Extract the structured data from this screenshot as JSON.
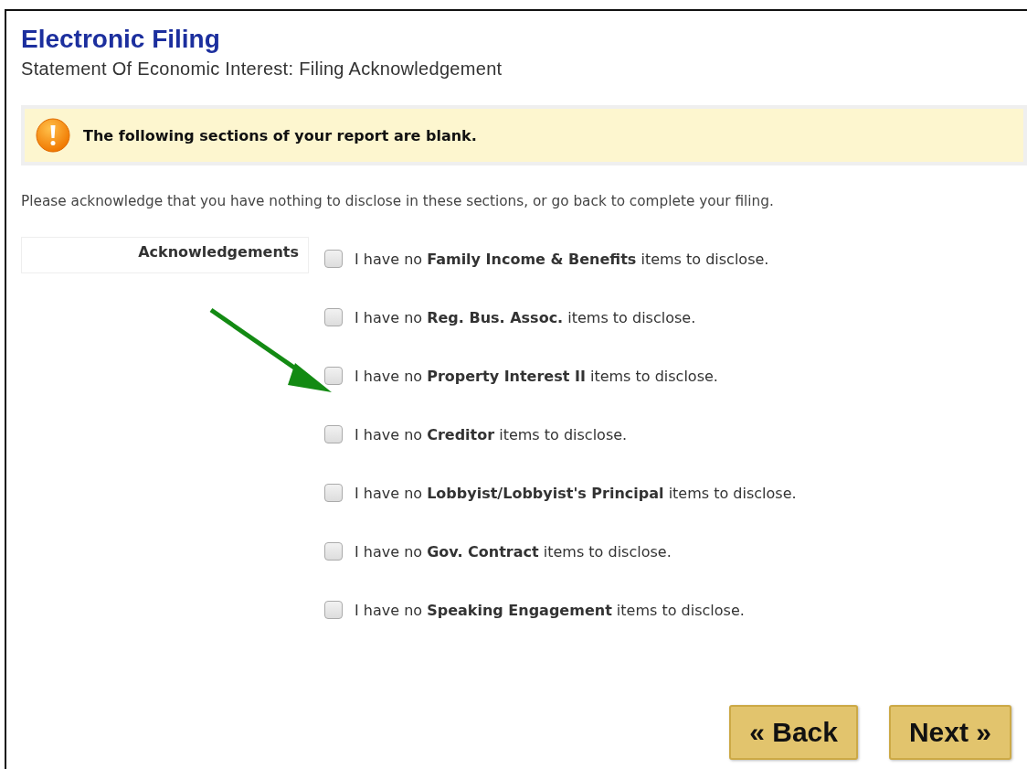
{
  "header": {
    "title": "Electronic Filing",
    "subtitle": "Statement Of Economic Interest: Filing Acknowledgement"
  },
  "alert": {
    "message": "The following sections of your report are blank."
  },
  "instructions": "Please acknowledge that you have nothing to disclose in these sections, or go back to complete your filing.",
  "acknowledgements": {
    "label": "Acknowledgements",
    "items": [
      {
        "text": "I have no **Family Income & Benefits** items to disclose.",
        "checked": false
      },
      {
        "text": "I have no **Reg. Bus. Assoc.** items to disclose.",
        "checked": false
      },
      {
        "text": "I have no **Property Interest II** items to disclose.",
        "checked": false
      },
      {
        "text": "I have no **Creditor** items to disclose.",
        "checked": false
      },
      {
        "text": "I have no **Lobbyist/Lobbyist's Principal** items to disclose.",
        "checked": false
      },
      {
        "text": "I have no **Gov. Contract** items to disclose.",
        "checked": false
      },
      {
        "text": "I have no **Speaking Engagement** items to disclose.",
        "checked": false
      }
    ]
  },
  "buttons": [
    "« Back",
    "Next »"
  ]
}
